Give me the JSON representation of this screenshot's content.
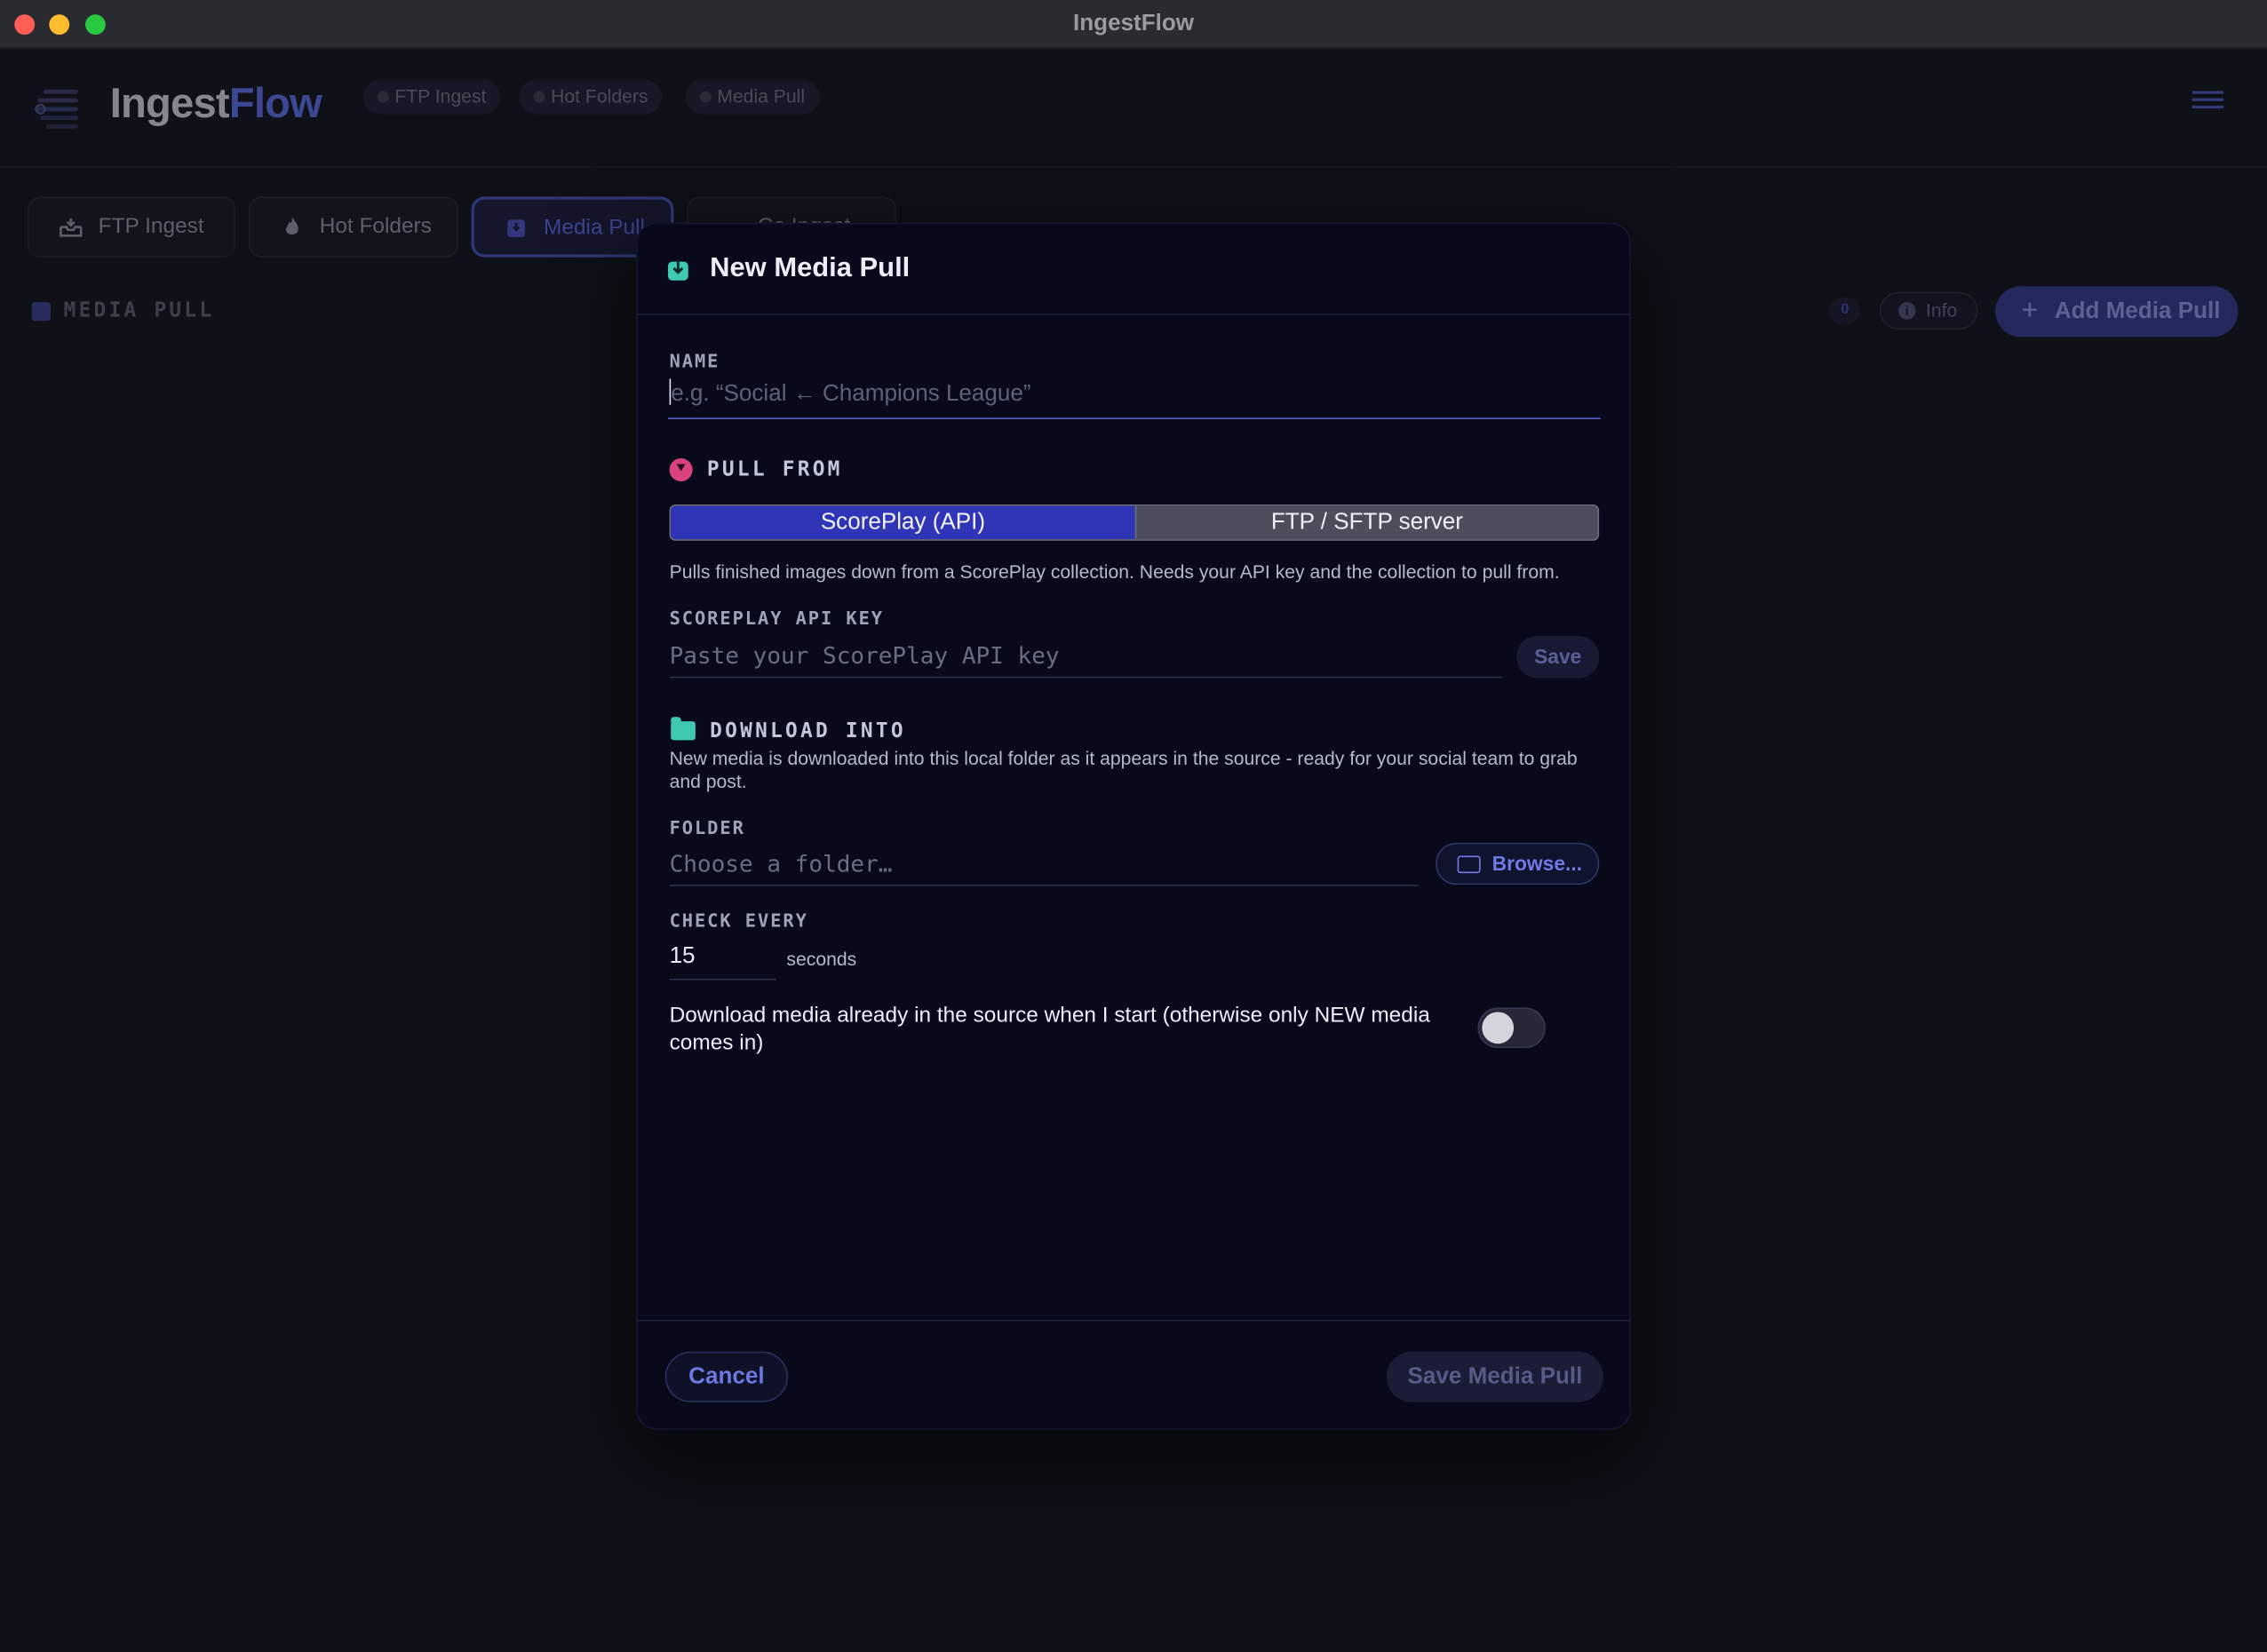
{
  "window": {
    "title": "IngestFlow"
  },
  "header": {
    "logo_part1": "Ingest",
    "logo_part2": "Flow",
    "status_pills": [
      "FTP Ingest",
      "Hot Folders",
      "Media Pull"
    ]
  },
  "tabs": [
    {
      "label": "FTP Ingest"
    },
    {
      "label": "Hot Folders"
    },
    {
      "label": "Media Pull"
    },
    {
      "label": "Co Ingest"
    }
  ],
  "section": {
    "title": "MEDIA PULL",
    "count": "0",
    "info_label": "Info",
    "add_label": "Add Media Pull"
  },
  "modal": {
    "title": "New Media Pull",
    "name_label": "NAME",
    "name_placeholder": "e.g. “Social ← Champions League”",
    "pull_from_label": "PULL FROM",
    "source_options": [
      "ScorePlay (API)",
      "FTP / SFTP server"
    ],
    "source_selected": "ScorePlay (API)",
    "source_help": "Pulls finished images down from a ScorePlay collection. Needs your API key and the collection to pull from.",
    "api_key_label": "SCOREPLAY API KEY",
    "api_key_placeholder": "Paste your ScorePlay API key",
    "api_key_save": "Save",
    "download_into_label": "DOWNLOAD INTO",
    "download_help": "New media is downloaded into this local folder as it appears in the source - ready for your social team to grab and post.",
    "folder_label": "FOLDER",
    "folder_placeholder": "Choose a folder…",
    "browse_label": "Browse...",
    "check_every_label": "CHECK EVERY",
    "check_every_value": "15",
    "check_every_unit": "seconds",
    "existing_media_text": "Download media already in the source when I start (otherwise only NEW media comes in)",
    "existing_media_enabled": false,
    "cancel_label": "Cancel",
    "save_label": "Save Media Pull"
  },
  "colors": {
    "accent": "#3035b7",
    "teal_icon": "#3ec9b0",
    "pink_icon": "#d9427f",
    "background": "#13141d",
    "modal_bg": "#080a1c"
  }
}
